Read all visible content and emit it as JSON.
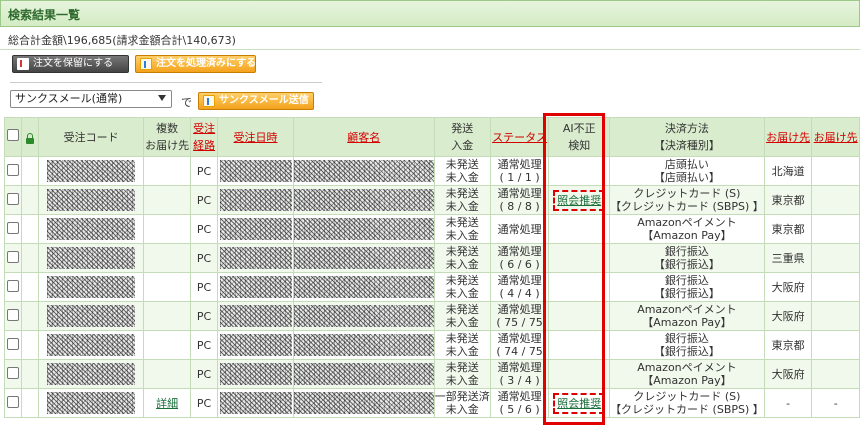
{
  "header": {
    "title": "検索結果一覧"
  },
  "summary": "総合計金額\\196,685(請求金額合計\\140,673)",
  "toolbar": {
    "hold_label": "注文を保留にする",
    "process_label": "注文を処理済みにする",
    "mail_select_value": "サンクスメール(通常)",
    "de": "で",
    "send_label": "サンクスメール送信"
  },
  "columns": {
    "order_code": "受注コード",
    "multi": [
      "複数",
      "お届け先"
    ],
    "route": [
      "受注",
      "経路"
    ],
    "order_date": "受注日時",
    "customer": "顧客名",
    "shipping": [
      "発送",
      "入金"
    ],
    "status": "ステータス",
    "ai": [
      "AI不正",
      "検知"
    ],
    "payment": [
      "決済方法",
      "【決済種別】"
    ],
    "dest": "お届け先",
    "dest2": "お届け先"
  },
  "rows": [
    {
      "multi": "",
      "route": "PC",
      "ship1": "未発送",
      "ship2": "未入金",
      "st1": "通常処理",
      "st2": "( 1 / 1 )",
      "ai": "",
      "pay1": "店頭払い",
      "pay2": "【店頭払い】",
      "dest": "北海道"
    },
    {
      "multi": "",
      "route": "PC",
      "ship1": "未発送",
      "ship2": "未入金",
      "st1": "通常処理",
      "st2": "( 8 / 8 )",
      "ai": "照会推奨",
      "pay1": "クレジットカード (S)",
      "pay2": "【クレジットカード (SBPS) 】",
      "dest": "東京都"
    },
    {
      "multi": "",
      "route": "PC",
      "ship1": "未発送",
      "ship2": "未入金",
      "st1": "通常処理",
      "st2": "",
      "ai": "",
      "pay1": "Amazonペイメント",
      "pay2": "【Amazon Pay】",
      "dest": "東京都"
    },
    {
      "multi": "",
      "route": "PC",
      "ship1": "未発送",
      "ship2": "未入金",
      "st1": "通常処理",
      "st2": "( 6 / 6 )",
      "ai": "",
      "pay1": "銀行振込",
      "pay2": "【銀行振込】",
      "dest": "三重県"
    },
    {
      "multi": "",
      "route": "PC",
      "ship1": "未発送",
      "ship2": "未入金",
      "st1": "通常処理",
      "st2": "( 4 / 4 )",
      "ai": "",
      "pay1": "銀行振込",
      "pay2": "【銀行振込】",
      "dest": "大阪府"
    },
    {
      "multi": "",
      "route": "PC",
      "ship1": "未発送",
      "ship2": "未入金",
      "st1": "通常処理",
      "st2": "( 75 / 75",
      "ai": "",
      "pay1": "Amazonペイメント",
      "pay2": "【Amazon Pay】",
      "dest": "大阪府"
    },
    {
      "multi": "",
      "route": "PC",
      "ship1": "未発送",
      "ship2": "未入金",
      "st1": "通常処理",
      "st2": "( 74 / 75",
      "ai": "",
      "pay1": "銀行振込",
      "pay2": "【銀行振込】",
      "dest": "東京都"
    },
    {
      "multi": "",
      "route": "PC",
      "ship1": "未発送",
      "ship2": "未入金",
      "st1": "通常処理",
      "st2": "( 3 / 4 )",
      "ai": "",
      "pay1": "Amazonペイメント",
      "pay2": "【Amazon Pay】",
      "dest": "大阪府"
    },
    {
      "multi": "詳細",
      "route": "PC",
      "ship1": "一部発送済",
      "ship2": "未入金",
      "st1": "通常処理",
      "st2": "( 5 / 6 )",
      "ai": "照会推奨",
      "pay1": "クレジットカード (S)",
      "pay2": "【クレジットカード (SBPS) 】",
      "dest": "-",
      "dest2": "-"
    }
  ]
}
